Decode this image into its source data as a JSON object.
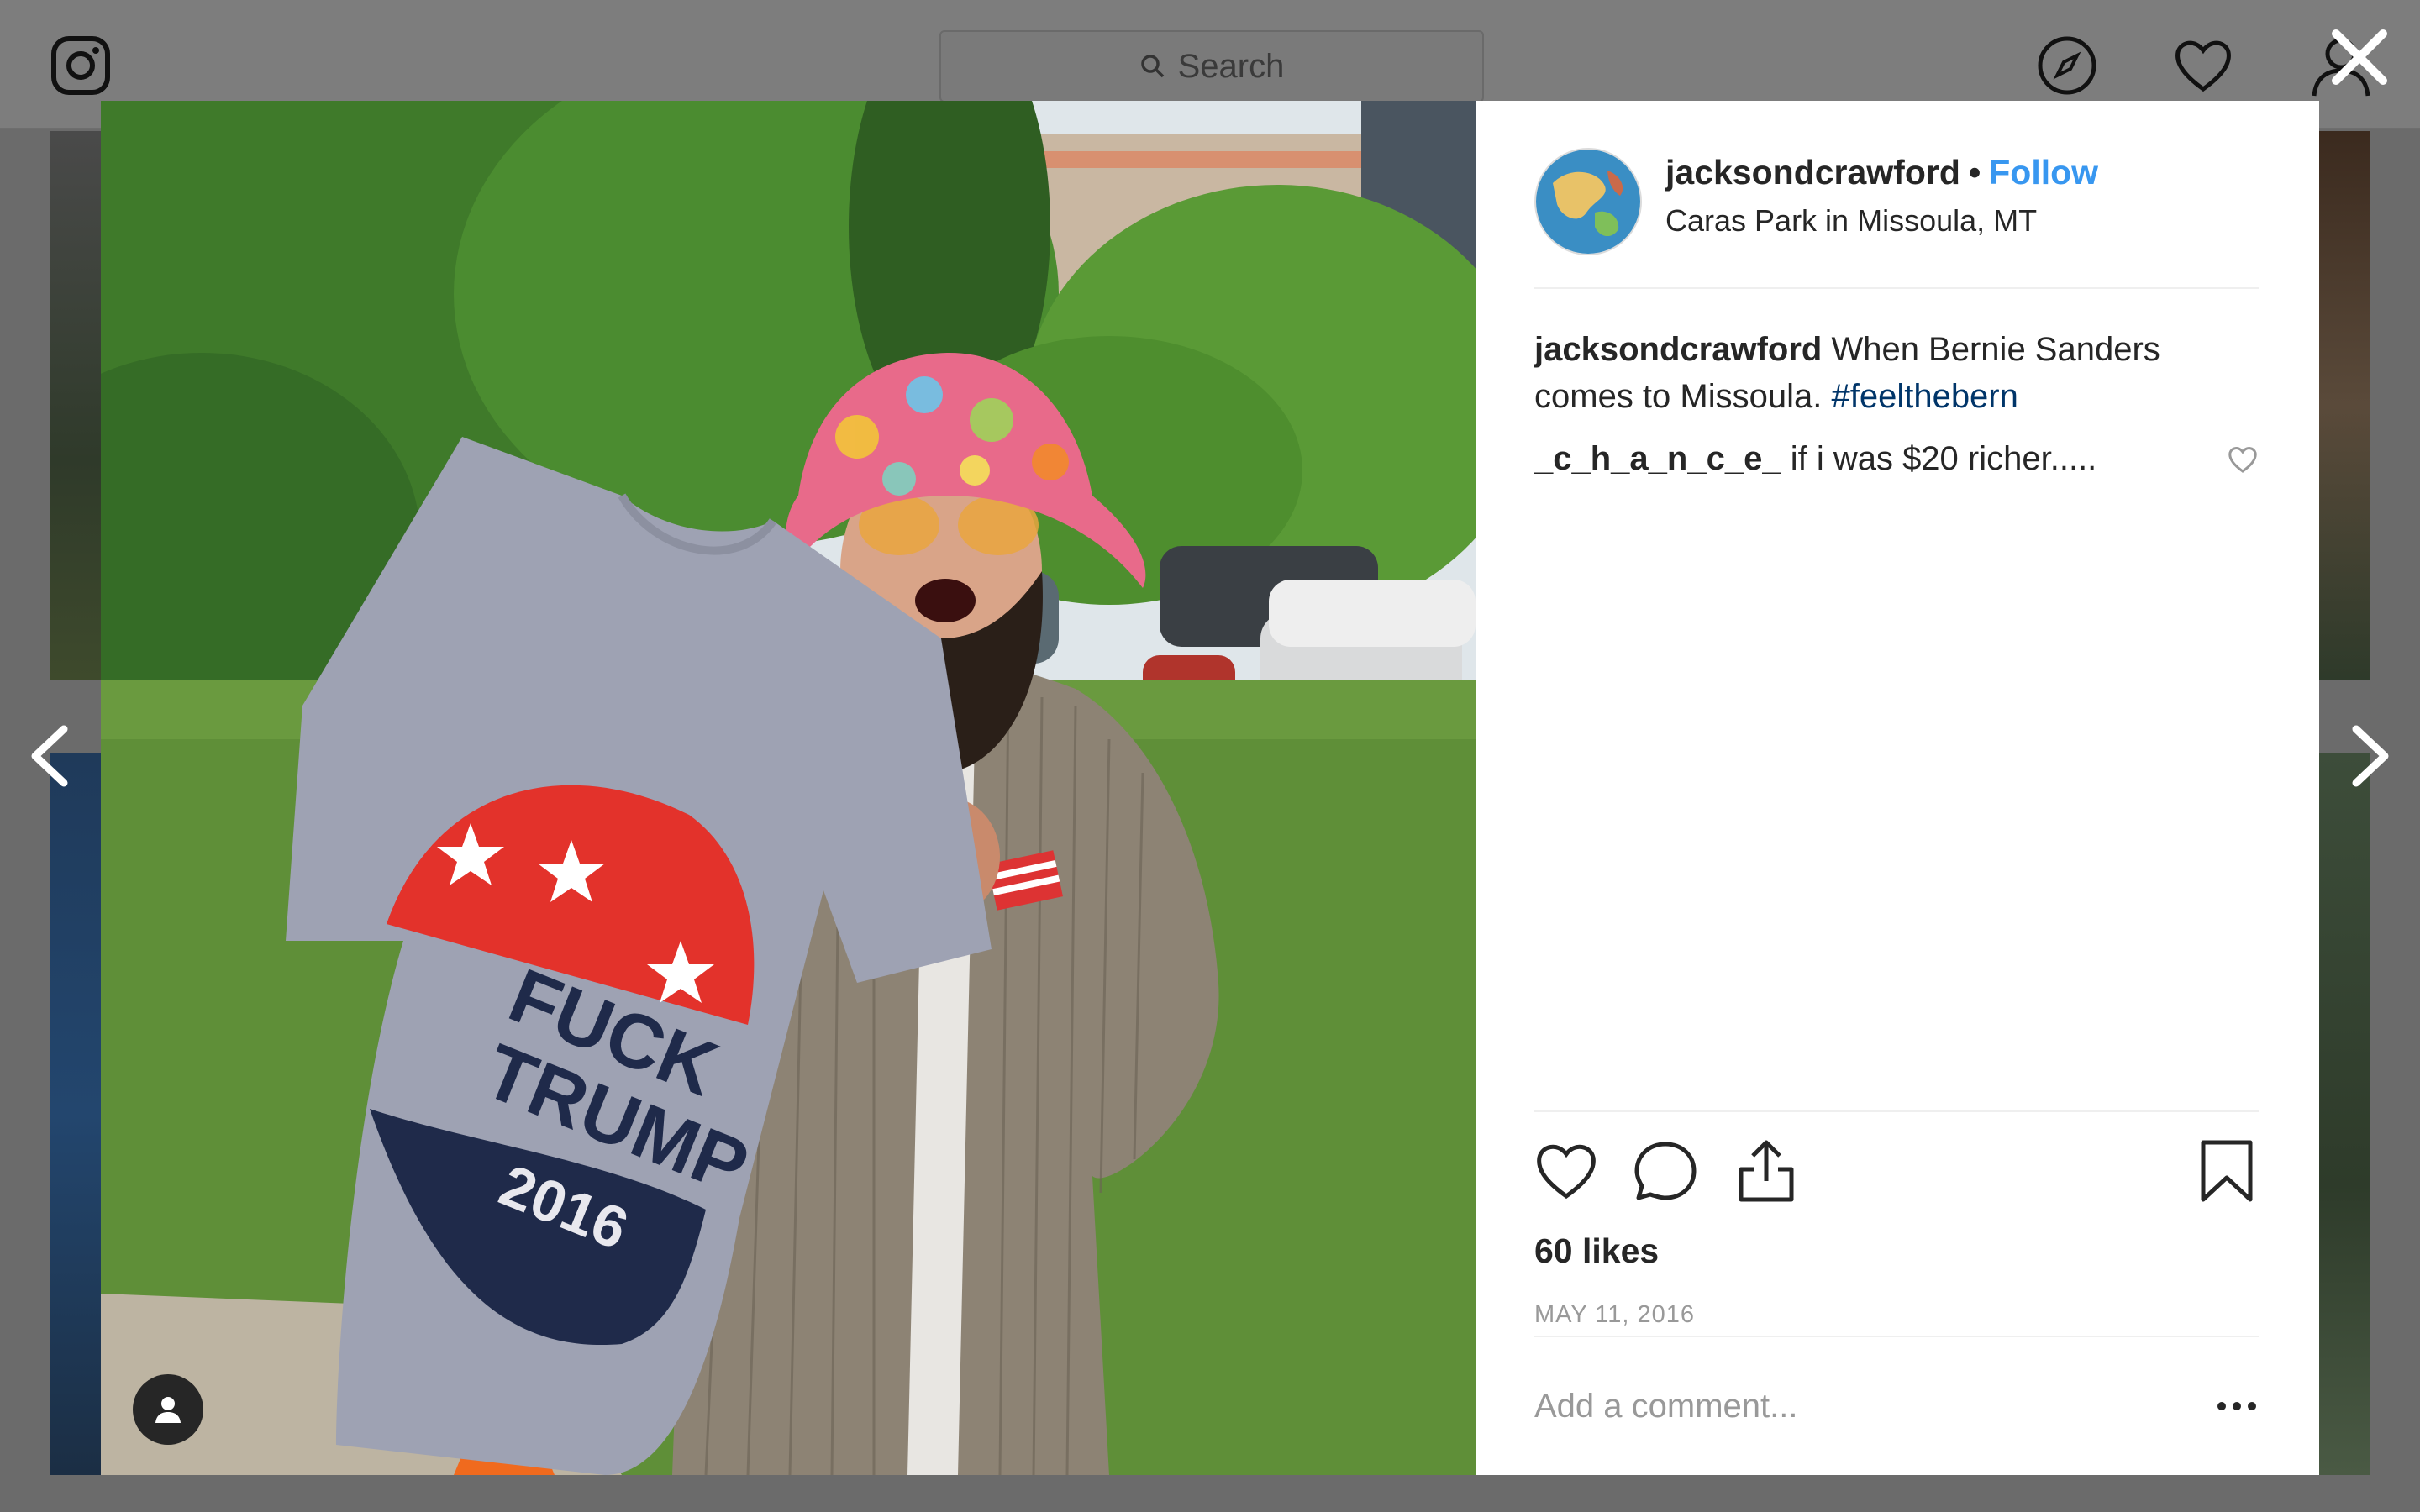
{
  "search": {
    "placeholder": "Search"
  },
  "post": {
    "username": "jacksondcrawford",
    "follow_label": "Follow",
    "separator": "•",
    "location": "Caras Park in Missoula, MT",
    "caption": {
      "author": "jacksondcrawford",
      "text": "When Bernie Sanders comes to Missoula.",
      "hashtag": "#feelthebern"
    },
    "comments": [
      {
        "author": "_c_h_a_n_c_e_",
        "text": "if i was $20 richer....."
      }
    ],
    "likes": "60 likes",
    "date": "MAY 11, 2016",
    "comment_placeholder": "Add a comment..."
  },
  "photo": {
    "shirt_line1": "FUCK",
    "shirt_line2": "TRUMP",
    "shirt_line3": "2016"
  },
  "colors": {
    "link_blue": "#3897f0",
    "hashtag_blue": "#003569",
    "text": "#262626",
    "muted": "#999999"
  },
  "icons": {
    "top_nav": [
      "instagram-logo-icon",
      "explore-compass-icon",
      "activity-heart-icon",
      "profile-icon"
    ],
    "actions": [
      "like-heart-icon",
      "comment-bubble-icon",
      "share-icon",
      "bookmark-icon"
    ]
  }
}
